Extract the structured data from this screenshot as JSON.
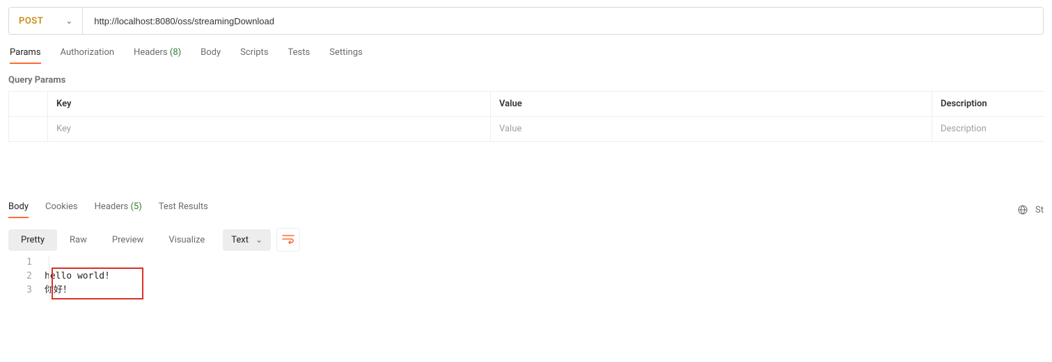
{
  "request": {
    "method": "POST",
    "url": "http://localhost:8080/oss/streamingDownload"
  },
  "tabs": {
    "params": "Params",
    "authorization": "Authorization",
    "headers": "Headers",
    "headers_count": "(8)",
    "body": "Body",
    "scripts": "Scripts",
    "tests": "Tests",
    "settings": "Settings"
  },
  "params": {
    "title": "Query Params",
    "columns": {
      "key": "Key",
      "value": "Value",
      "description": "Description"
    },
    "placeholders": {
      "key": "Key",
      "value": "Value",
      "description": "Description"
    }
  },
  "response": {
    "tabs": {
      "body": "Body",
      "cookies": "Cookies",
      "headers": "Headers",
      "headers_count": "(5)",
      "test_results": "Test Results"
    },
    "status_abbrev": "St",
    "view": {
      "pretty": "Pretty",
      "raw": "Raw",
      "preview": "Preview",
      "visualize": "Visualize",
      "type": "Text"
    },
    "body_lines": [
      "",
      "hello world!",
      "你好！"
    ]
  }
}
